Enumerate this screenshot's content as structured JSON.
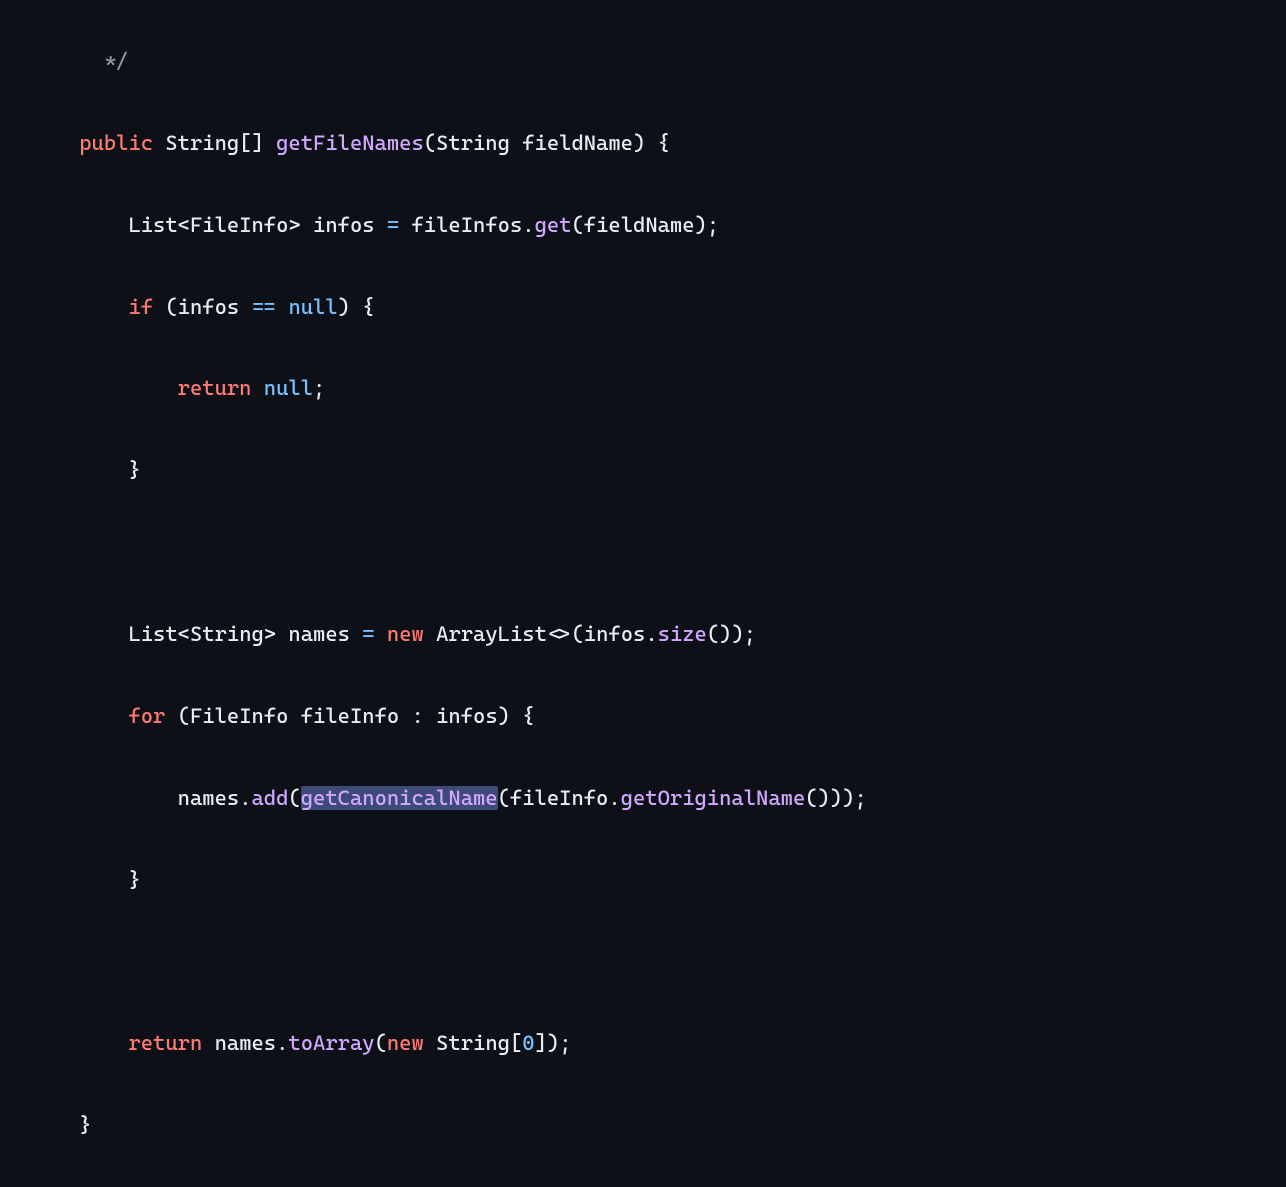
{
  "code": {
    "line1": {
      "comment_close": " */"
    },
    "line2": {
      "kw_public": "public",
      "type_string": "String",
      "brackets": "[]",
      "method": "getFileNames",
      "paren_open": "(",
      "param_type": "String",
      "param_name": "fieldName",
      "paren_close": ")",
      "brace_open": "{"
    },
    "line3": {
      "type_list": "List",
      "lt": "<",
      "type_fileinfo": "FileInfo",
      "gt": ">",
      "var_infos": "infos",
      "eq": "=",
      "var_fileinfos": "fileInfos",
      "dot": ".",
      "method_get": "get",
      "paren_open": "(",
      "arg": "fieldName",
      "paren_close": ")",
      "semi": ";"
    },
    "line4": {
      "kw_if": "if",
      "paren_open": "(",
      "var_infos": "infos",
      "eq_eq": "==",
      "kw_null": "null",
      "paren_close": ")",
      "brace_open": "{"
    },
    "line5": {
      "kw_return": "return",
      "kw_null": "null",
      "semi": ";"
    },
    "line6": {
      "brace_close": "}"
    },
    "line8": {
      "type_list": "List",
      "lt": "<",
      "type_string": "String",
      "gt": ">",
      "var_names": "names",
      "eq": "=",
      "kw_new": "new",
      "type_arraylist": "ArrayList",
      "diamond": "<>",
      "paren_open": "(",
      "var_infos": "infos",
      "dot": ".",
      "method_size": "size",
      "parens": "()",
      "paren_close": ")",
      "semi": ";"
    },
    "line9": {
      "kw_for": "for",
      "paren_open": "(",
      "type_fileinfo": "FileInfo",
      "var_fileinfo": "fileInfo",
      "colon": ":",
      "var_infos": "infos",
      "paren_close": ")",
      "brace_open": "{"
    },
    "line10": {
      "var_names": "names",
      "dot1": ".",
      "method_add": "add",
      "paren_open": "(",
      "method_canonical": "getCanonicalName",
      "paren_open2": "(",
      "var_fileinfo": "fileInfo",
      "dot2": ".",
      "method_original": "getOriginalName",
      "parens": "()",
      "paren_close2": ")",
      "paren_close": ")",
      "semi": ";"
    },
    "line11": {
      "brace_close": "}"
    },
    "line13": {
      "kw_return": "return",
      "var_names": "names",
      "dot": ".",
      "method_toarray": "toArray",
      "paren_open": "(",
      "kw_new": "new",
      "type_string": "String",
      "bracket_open": "[",
      "num_zero": "0",
      "bracket_close": "]",
      "paren_close": ")",
      "semi": ";"
    },
    "line14": {
      "brace_close": "}"
    }
  }
}
